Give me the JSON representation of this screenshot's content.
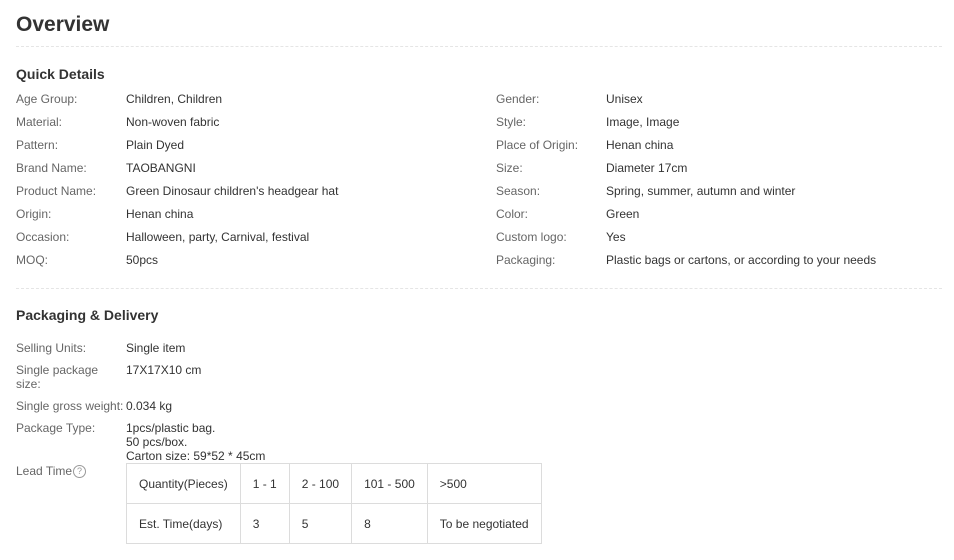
{
  "overview": {
    "title": "Overview"
  },
  "quick_details": {
    "title": "Quick Details",
    "left": [
      {
        "label": "Age Group:",
        "value": "Children, Children"
      },
      {
        "label": "Material:",
        "value": "Non-woven fabric"
      },
      {
        "label": "Pattern:",
        "value": "Plain Dyed"
      },
      {
        "label": "Brand Name:",
        "value": "TAOBANGNI"
      },
      {
        "label": "Product Name:",
        "value": "Green Dinosaur children's headgear hat"
      },
      {
        "label": "Origin:",
        "value": "Henan china"
      },
      {
        "label": "Occasion:",
        "value": "Halloween, party, Carnival, festival"
      },
      {
        "label": "MOQ:",
        "value": "50pcs"
      }
    ],
    "right": [
      {
        "label": "Gender:",
        "value": "Unisex"
      },
      {
        "label": "Style:",
        "value": "Image, Image"
      },
      {
        "label": "Place of Origin:",
        "value": "Henan china"
      },
      {
        "label": "Size:",
        "value": "Diameter 17cm"
      },
      {
        "label": "Season:",
        "value": "Spring, summer, autumn and winter"
      },
      {
        "label": "Color:",
        "value": "Green"
      },
      {
        "label": "Custom logo:",
        "value": "Yes"
      },
      {
        "label": "Packaging:",
        "value": "Plastic bags or cartons, or according to your needs"
      }
    ]
  },
  "packaging": {
    "title": "Packaging & Delivery",
    "selling_units": {
      "label": "Selling Units:",
      "value": "Single item"
    },
    "package_size": {
      "label": "Single package size:",
      "value": "17X17X10 cm"
    },
    "gross_weight": {
      "label": "Single gross weight:",
      "value": "0.034 kg"
    },
    "package_type": {
      "label": "Package Type:",
      "lines": [
        "1pcs/plastic bag.",
        "50 pcs/box.",
        "Carton size: 59*52 * 45cm"
      ]
    },
    "lead_time": {
      "label": "Lead Time",
      "help_icon": "question-circle-icon",
      "help_glyph": "?",
      "header": [
        "Quantity(Pieces)",
        "1 - 1",
        "2 - 100",
        "101 - 500",
        ">500"
      ],
      "row": [
        "Est. Time(days)",
        "3",
        "5",
        "8",
        "To be negotiated"
      ]
    }
  }
}
